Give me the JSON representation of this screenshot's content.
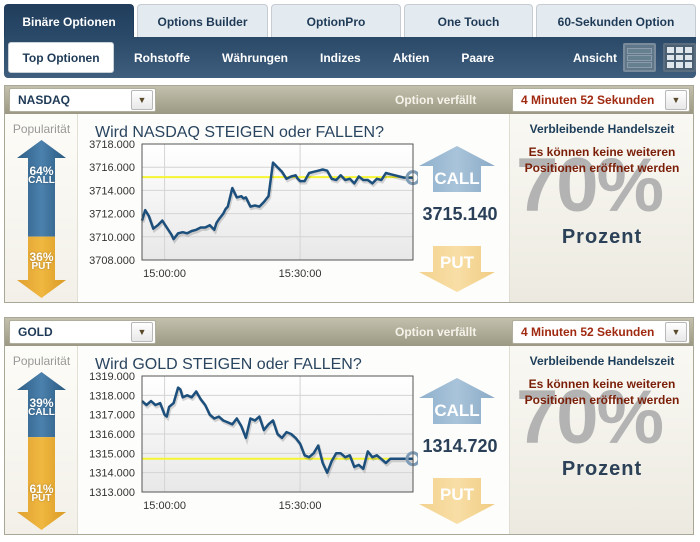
{
  "tabs": [
    {
      "label": "Binäre Optionen",
      "active": true
    },
    {
      "label": "Options Builder",
      "active": false
    },
    {
      "label": "OptionPro",
      "active": false
    },
    {
      "label": "One Touch",
      "active": false
    },
    {
      "label": "60-Sekunden Option",
      "active": false
    }
  ],
  "nav": {
    "items": [
      {
        "label": "Top Optionen",
        "active": true
      },
      {
        "label": "Rohstoffe"
      },
      {
        "label": "Währungen"
      },
      {
        "label": "Indizes"
      },
      {
        "label": "Aktien"
      },
      {
        "label": "Paare"
      }
    ],
    "view_label": "Ansicht",
    "view_icons": [
      "list-view-icon",
      "grid-view-icon"
    ]
  },
  "colors": {
    "nav_dark": "#2a4a6a",
    "call_blue": "#3b6e96",
    "put_orange": "#e9ad33",
    "line": "#1c4f7c",
    "strike_line": "#f5f531",
    "warning_text": "#7a1e08",
    "expiry_text": "#a02a10"
  },
  "panels": [
    {
      "asset": "NASDAQ",
      "expiry_label": "Option verfällt",
      "expiry_value": "4 Minuten 52 Sekunden",
      "popularity_label": "Popularität",
      "call_pct": "64%",
      "call_label": "CALL",
      "put_pct": "36%",
      "put_label": "PUT",
      "call_share": 0.64,
      "question": "Wird NASDAQ STEIGEN oder FALLEN?",
      "call_button": "CALL",
      "put_button": "PUT",
      "price": "3715.140",
      "trading_time_label": "Verbleibende Handelszeit",
      "warning": "Es können keine weiteren Positionen eröffnet werden",
      "payout": "70%",
      "payout_label": "Prozent"
    },
    {
      "asset": "GOLD",
      "expiry_label": "Option verfällt",
      "expiry_value": "4 Minuten 52 Sekunden",
      "popularity_label": "Popularität",
      "call_pct": "39%",
      "call_label": "CALL",
      "put_pct": "61%",
      "put_label": "PUT",
      "call_share": 0.39,
      "question": "Wird GOLD STEIGEN oder FALLEN?",
      "call_button": "CALL",
      "put_button": "PUT",
      "price": "1314.720",
      "trading_time_label": "Verbleibende Handelszeit",
      "warning": "Es können keine weiteren Positionen eröffnet werden",
      "payout": "70%",
      "payout_label": "Prozent"
    }
  ],
  "chart_data": [
    {
      "type": "line",
      "title": "NASDAQ",
      "ylim": [
        3708,
        3718
      ],
      "yticks": [
        "3718.000",
        "3716.000",
        "3714.000",
        "3712.000",
        "3710.000",
        "3708.000"
      ],
      "ytick_values": [
        3718,
        3716,
        3714,
        3712,
        3710,
        3708
      ],
      "xlim_minutes": [
        -5,
        55
      ],
      "xticks": [
        "15:00:00",
        "15:30:00"
      ],
      "xtick_minutes": [
        0,
        30
      ],
      "strike": 3715.14,
      "grid": true,
      "series": [
        {
          "name": "NASDAQ",
          "x_minutes": [
            -5,
            -4.3,
            -3.5,
            -2.5,
            -1.5,
            -0.5,
            0.5,
            1.5,
            2,
            3,
            4,
            5,
            6,
            7,
            8,
            9,
            10,
            11,
            11.5,
            12,
            13,
            13.5,
            14,
            15,
            16,
            17,
            17.5,
            18,
            19,
            20,
            21,
            22,
            23,
            24,
            25,
            26,
            27,
            28,
            29,
            29.5,
            30,
            31,
            32,
            33,
            34,
            35,
            36,
            37,
            38,
            39,
            40,
            41,
            42,
            43,
            44,
            45,
            46,
            47,
            48,
            49,
            50,
            51,
            52,
            53,
            54,
            55
          ],
          "values": [
            3711.4,
            3712.3,
            3711.8,
            3710.7,
            3711.0,
            3711.4,
            3710.8,
            3710.2,
            3709.8,
            3710.3,
            3710.4,
            3710.3,
            3710.5,
            3710.6,
            3710.8,
            3710.8,
            3711.0,
            3710.6,
            3711.2,
            3711.5,
            3712.0,
            3712.4,
            3712.6,
            3714.2,
            3713.4,
            3713.5,
            3713.3,
            3713.4,
            3712.6,
            3712.7,
            3712.6,
            3713.0,
            3713.5,
            3716.4,
            3716.0,
            3715.6,
            3715.0,
            3715.2,
            3715.3,
            3715.0,
            3714.8,
            3714.8,
            3715.5,
            3715.6,
            3715.7,
            3715.8,
            3715.7,
            3715.0,
            3714.9,
            3715.3,
            3714.9,
            3715.0,
            3714.6,
            3715.2,
            3714.9,
            3714.9,
            3714.6,
            3715.0,
            3714.9,
            3715.5,
            3715.4,
            3715.3,
            3715.2,
            3715.1,
            3715.1,
            3715.1
          ]
        }
      ]
    },
    {
      "type": "line",
      "title": "GOLD",
      "ylim": [
        1313,
        1319
      ],
      "yticks": [
        "1319.000",
        "1318.000",
        "1317.000",
        "1316.000",
        "1315.000",
        "1314.000",
        "1313.000"
      ],
      "ytick_values": [
        1319,
        1318,
        1317,
        1316,
        1315,
        1314,
        1313
      ],
      "xlim_minutes": [
        -5,
        55
      ],
      "xticks": [
        "15:00:00",
        "15:30:00"
      ],
      "xtick_minutes": [
        0,
        30
      ],
      "strike": 1314.72,
      "grid": true,
      "series": [
        {
          "name": "GOLD",
          "x_minutes": [
            -5,
            -4,
            -3,
            -2,
            -1,
            0,
            0.5,
            1,
            2,
            3,
            3.5,
            4,
            5,
            6,
            7,
            8,
            9,
            10,
            11,
            12,
            13,
            14,
            15,
            16,
            17,
            18,
            19,
            20,
            21,
            22,
            23,
            24,
            25,
            26,
            27,
            28,
            29,
            30,
            31,
            32,
            33,
            34,
            35,
            36,
            37,
            38,
            39,
            40,
            41,
            42,
            43,
            44,
            45,
            46,
            47,
            48,
            49,
            50,
            51,
            52,
            53,
            54,
            55
          ],
          "values": [
            1317.7,
            1317.5,
            1317.7,
            1317.5,
            1317.6,
            1317.0,
            1316.9,
            1317.4,
            1317.6,
            1318.4,
            1318.3,
            1317.9,
            1318.0,
            1317.9,
            1318.2,
            1317.8,
            1317.5,
            1317.0,
            1316.8,
            1316.9,
            1316.7,
            1316.6,
            1316.5,
            1316.8,
            1316.4,
            1315.8,
            1316.8,
            1316.7,
            1316.9,
            1316.2,
            1316.5,
            1316.7,
            1316.0,
            1315.8,
            1316.1,
            1316.0,
            1315.8,
            1315.5,
            1314.9,
            1314.8,
            1315.0,
            1315.4,
            1314.5,
            1314.0,
            1314.6,
            1315.0,
            1315.0,
            1314.8,
            1314.9,
            1314.3,
            1314.4,
            1314.2,
            1315.1,
            1314.8,
            1314.9,
            1314.7,
            1314.5,
            1314.72,
            1314.72,
            1314.72,
            1314.72,
            1314.72,
            1314.72
          ]
        }
      ]
    }
  ]
}
